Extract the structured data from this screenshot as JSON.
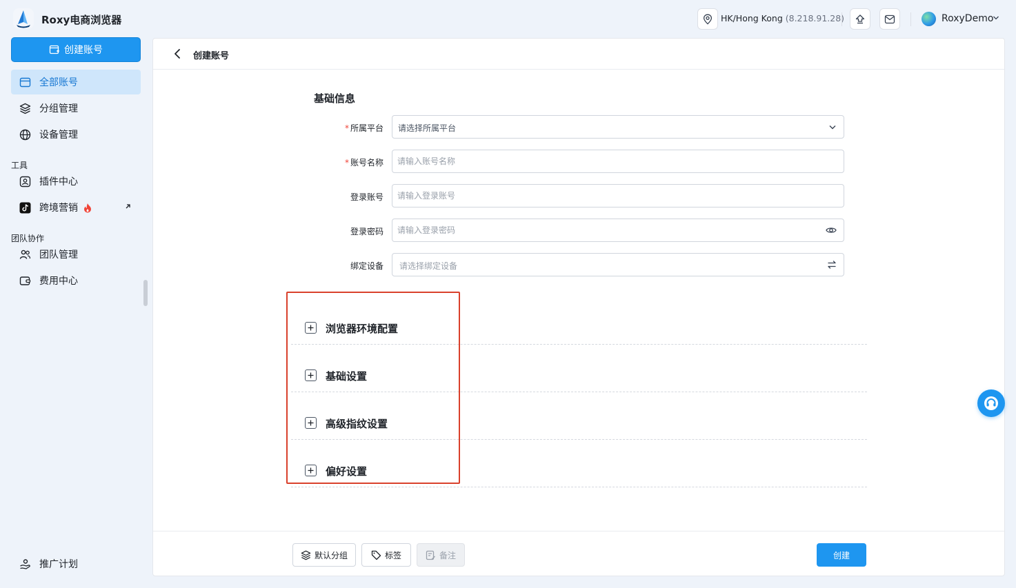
{
  "app": {
    "title": "Roxy电商浏览器"
  },
  "topbar": {
    "location": "HK/Hong Kong",
    "ip": "(8.218.91.28)",
    "user": "RoxyDemo"
  },
  "sidebar": {
    "create_button": "创建账号",
    "items": [
      {
        "label": "全部账号",
        "icon": "browser-window-icon",
        "active": true
      },
      {
        "label": "分组管理",
        "icon": "layers-icon"
      },
      {
        "label": "设备管理",
        "icon": "globe-icon"
      }
    ],
    "tools_section": "工具",
    "tools": [
      {
        "label": "插件中心",
        "icon": "plugin-icon"
      },
      {
        "label": "跨境营销",
        "icon": "tiktok-icon",
        "badge": "fire-icon",
        "external": true
      }
    ],
    "team_section": "团队协作",
    "team": [
      {
        "label": "团队管理",
        "icon": "users-icon"
      },
      {
        "label": "费用中心",
        "icon": "wallet-icon"
      }
    ],
    "bottom": {
      "label": "推广计划",
      "icon": "handshake-icon"
    }
  },
  "page": {
    "title": "创建账号",
    "section_title": "基础信息",
    "fields": {
      "platform": {
        "label": "所属平台",
        "required": true,
        "placeholder": "请选择所属平台"
      },
      "account_name": {
        "label": "账号名称",
        "required": true,
        "placeholder": "请输入账号名称"
      },
      "login_account": {
        "label": "登录账号",
        "required": false,
        "placeholder": "请输入登录账号"
      },
      "login_password": {
        "label": "登录密码",
        "required": false,
        "placeholder": "请输入登录密码"
      },
      "device": {
        "label": "绑定设备",
        "required": false,
        "placeholder": "请选择绑定设备"
      }
    },
    "required_mark": "*",
    "collapses": [
      {
        "label": "浏览器环境配置"
      },
      {
        "label": "基础设置"
      },
      {
        "label": "高级指纹设置"
      },
      {
        "label": "偏好设置"
      }
    ],
    "footer": {
      "group_button": "默认分组",
      "tag_button": "标签",
      "remark_button": "备注",
      "create_button": "创建"
    }
  },
  "colors": {
    "primary": "#1e96f0",
    "highlight": "#d9402b",
    "required": "#f04438"
  }
}
